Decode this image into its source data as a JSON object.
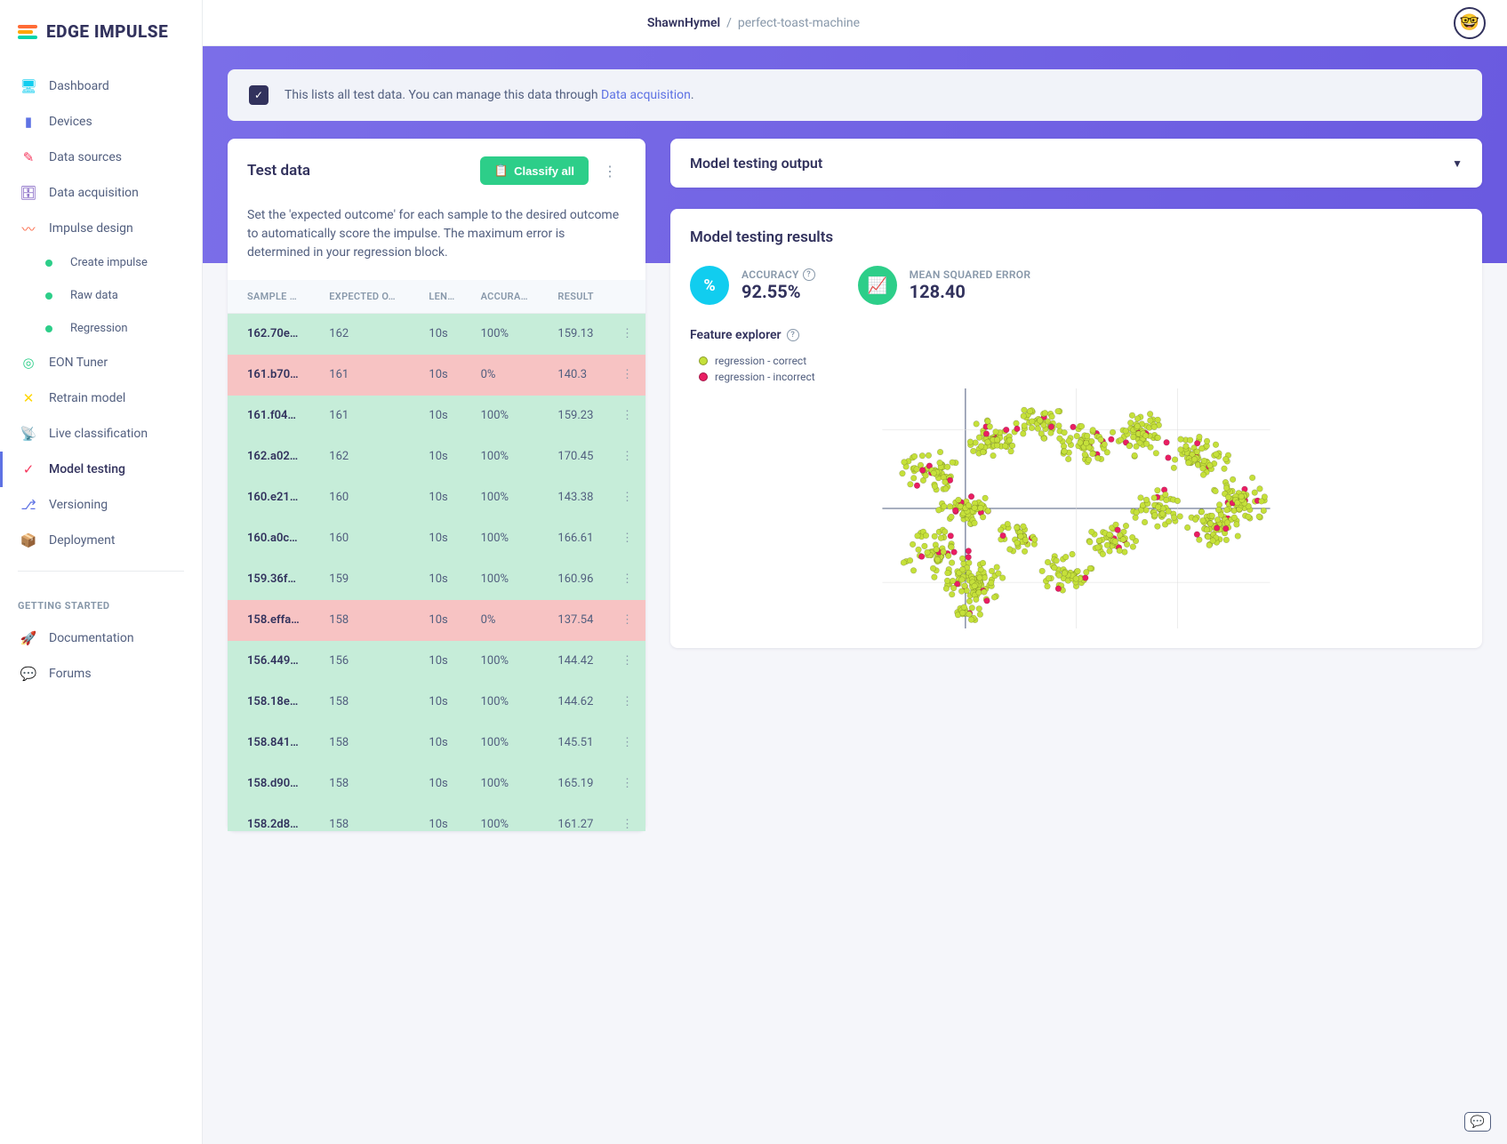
{
  "brand": "EDGE IMPULSE",
  "breadcrumb": {
    "user": "ShawnHymel",
    "project": "perfect-toast-machine"
  },
  "nav": {
    "items": [
      {
        "label": "Dashboard",
        "icon": "🖥",
        "color": "#11cdef"
      },
      {
        "label": "Devices",
        "icon": "▮",
        "color": "#5e72e4"
      },
      {
        "label": "Data sources",
        "icon": "✎",
        "color": "#f5365c"
      },
      {
        "label": "Data acquisition",
        "icon": "🗄",
        "color": "#5e35b1"
      },
      {
        "label": "Impulse design",
        "icon": "〰",
        "color": "#fb6340"
      },
      {
        "label": "EON Tuner",
        "icon": "◎",
        "color": "#2dce89"
      },
      {
        "label": "Retrain model",
        "icon": "✕",
        "color": "#ffd600"
      },
      {
        "label": "Live classification",
        "icon": "📡",
        "color": "#2dce89"
      },
      {
        "label": "Model testing",
        "icon": "✓",
        "color": "#f5365c",
        "active": true
      },
      {
        "label": "Versioning",
        "icon": "⎇",
        "color": "#5e72e4"
      },
      {
        "label": "Deployment",
        "icon": "📦",
        "color": "#f5365c"
      }
    ],
    "sub_items": [
      "Create impulse",
      "Raw data",
      "Regression"
    ],
    "getting_started_label": "GETTING STARTED",
    "docs": "Documentation",
    "forums": "Forums"
  },
  "banner": {
    "text_before": "This lists all test data. You can manage this data through ",
    "link": "Data acquisition",
    "text_after": "."
  },
  "test_data": {
    "title": "Test data",
    "classify_label": "Classify all",
    "description": "Set the 'expected outcome' for each sample to the desired outcome to automatically score the impulse. The maximum error is determined in your regression block.",
    "columns": [
      "SAMPLE …",
      "EXPECTED O…",
      "LEN…",
      "ACCURA…",
      "RESULT"
    ],
    "rows": [
      {
        "sample": "162.70e…",
        "expected": "162",
        "length": "10s",
        "accuracy": "100%",
        "result": "159.13",
        "status": "correct"
      },
      {
        "sample": "161.b70…",
        "expected": "161",
        "length": "10s",
        "accuracy": "0%",
        "result": "140.3",
        "status": "incorrect"
      },
      {
        "sample": "161.f04…",
        "expected": "161",
        "length": "10s",
        "accuracy": "100%",
        "result": "159.23",
        "status": "correct"
      },
      {
        "sample": "162.a02…",
        "expected": "162",
        "length": "10s",
        "accuracy": "100%",
        "result": "170.45",
        "status": "correct"
      },
      {
        "sample": "160.e21…",
        "expected": "160",
        "length": "10s",
        "accuracy": "100%",
        "result": "143.38",
        "status": "correct"
      },
      {
        "sample": "160.a0c…",
        "expected": "160",
        "length": "10s",
        "accuracy": "100%",
        "result": "166.61",
        "status": "correct"
      },
      {
        "sample": "159.36f…",
        "expected": "159",
        "length": "10s",
        "accuracy": "100%",
        "result": "160.96",
        "status": "correct"
      },
      {
        "sample": "158.effa…",
        "expected": "158",
        "length": "10s",
        "accuracy": "0%",
        "result": "137.54",
        "status": "incorrect"
      },
      {
        "sample": "156.449…",
        "expected": "156",
        "length": "10s",
        "accuracy": "100%",
        "result": "144.42",
        "status": "correct"
      },
      {
        "sample": "158.18e…",
        "expected": "158",
        "length": "10s",
        "accuracy": "100%",
        "result": "144.62",
        "status": "correct"
      },
      {
        "sample": "158.841…",
        "expected": "158",
        "length": "10s",
        "accuracy": "100%",
        "result": "145.51",
        "status": "correct"
      },
      {
        "sample": "158.d90…",
        "expected": "158",
        "length": "10s",
        "accuracy": "100%",
        "result": "165.19",
        "status": "correct"
      },
      {
        "sample": "158.2d8…",
        "expected": "158",
        "length": "10s",
        "accuracy": "100%",
        "result": "161.27",
        "status": "correct"
      }
    ]
  },
  "output": {
    "title": "Model testing output"
  },
  "results": {
    "title": "Model testing results",
    "accuracy_label": "ACCURACY",
    "accuracy_value": "92.55%",
    "mse_label": "MEAN SQUARED ERROR",
    "mse_value": "128.40",
    "explorer_title": "Feature explorer",
    "legend_correct": "regression - correct",
    "legend_incorrect": "regression - incorrect"
  },
  "chart_data": {
    "type": "scatter",
    "title": "Feature explorer",
    "series": [
      {
        "name": "regression - correct",
        "color": "#c5e03a"
      },
      {
        "name": "regression - incorrect",
        "color": "#e91e63"
      }
    ],
    "note": "Dense 2D feature scatter; exact coordinates not labeled in source image. Roughly ~1000 points, ~92.5% correct (yellow-green) and ~7.5% incorrect (pink), forming a curved band with branching clusters across the plot area.",
    "xrange": [
      -1,
      1
    ],
    "yrange": [
      -1,
      1
    ]
  }
}
